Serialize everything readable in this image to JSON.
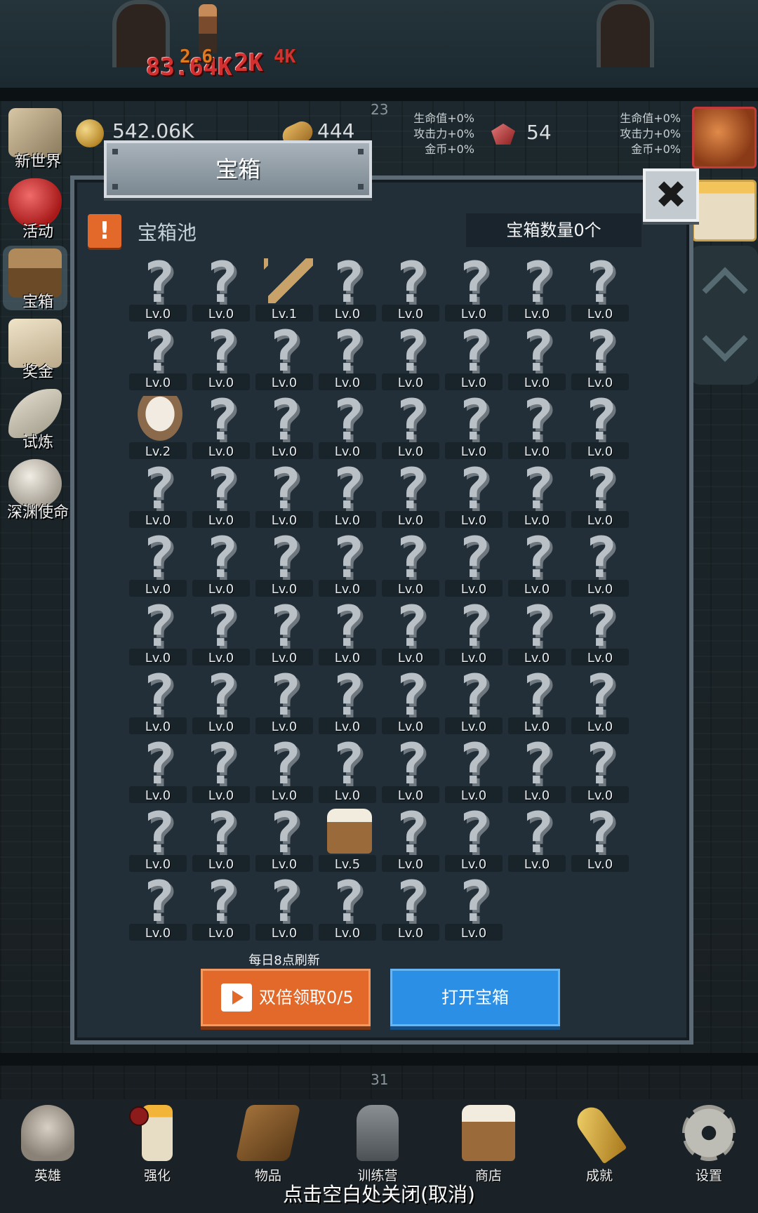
{
  "battle": {
    "damage_1": "83.64K",
    "damage_2": "2.6",
    "damage_3": "2K",
    "damage_4": "4K"
  },
  "resources": {
    "gold": "542.06K",
    "bread": "444",
    "gem": "54",
    "left_wave": "23",
    "bottom_wave": "31",
    "left_buffs": [
      "生命值+0%",
      "攻击力+0%",
      "金币+0%"
    ],
    "right_buffs": [
      "生命值+0%",
      "攻击力+0%",
      "金币+0%"
    ]
  },
  "sidebar": {
    "items": [
      {
        "label": "新世界",
        "icon": "map-icon"
      },
      {
        "label": "活动",
        "icon": "heart-icon"
      },
      {
        "label": "宝箱",
        "icon": "treasure-chest-icon"
      },
      {
        "label": "奖金",
        "icon": "envelope-icon"
      },
      {
        "label": "试炼",
        "icon": "feather-icon"
      },
      {
        "label": "深渊使命",
        "icon": "orb-icon"
      }
    ]
  },
  "dialog": {
    "title": "宝箱",
    "close_label": "✖",
    "alert_mark": "!",
    "pool_title": "宝箱池",
    "chest_count": "宝箱数量0个",
    "refresh_note": "每日8点刷新",
    "double_claim_label": "双倍领取0/5",
    "open_chest_label": "打开宝箱",
    "slots": [
      "Lv.0",
      "Lv.0",
      "Lv.1",
      "Lv.0",
      "Lv.0",
      "Lv.0",
      "Lv.0",
      "Lv.0",
      "Lv.0",
      "Lv.0",
      "Lv.0",
      "Lv.0",
      "Lv.0",
      "Lv.0",
      "Lv.0",
      "Lv.0",
      "Lv.2",
      "Lv.0",
      "Lv.0",
      "Lv.0",
      "Lv.0",
      "Lv.0",
      "Lv.0",
      "Lv.0",
      "Lv.0",
      "Lv.0",
      "Lv.0",
      "Lv.0",
      "Lv.0",
      "Lv.0",
      "Lv.0",
      "Lv.0",
      "Lv.0",
      "Lv.0",
      "Lv.0",
      "Lv.0",
      "Lv.0",
      "Lv.0",
      "Lv.0",
      "Lv.0",
      "Lv.0",
      "Lv.0",
      "Lv.0",
      "Lv.0",
      "Lv.0",
      "Lv.0",
      "Lv.0",
      "Lv.0",
      "Lv.0",
      "Lv.0",
      "Lv.0",
      "Lv.0",
      "Lv.0",
      "Lv.0",
      "Lv.0",
      "Lv.0",
      "Lv.0",
      "Lv.0",
      "Lv.0",
      "Lv.0",
      "Lv.0",
      "Lv.0",
      "Lv.0",
      "Lv.0",
      "Lv.0",
      "Lv.0",
      "Lv.0",
      "Lv.5",
      "Lv.0",
      "Lv.0",
      "Lv.0",
      "Lv.0",
      "Lv.0",
      "Lv.0",
      "Lv.0",
      "Lv.0",
      "Lv.0",
      "Lv.0"
    ],
    "slot_icons": {
      "2": "sword-icon",
      "16": "rice-bowl-icon",
      "67": "beer-mug-icon"
    }
  },
  "bottom_nav": {
    "items": [
      {
        "label": "英雄",
        "icon": "skull-icon"
      },
      {
        "label": "强化",
        "icon": "candle-icon"
      },
      {
        "label": "物品",
        "icon": "book-icon"
      },
      {
        "label": "训练营",
        "icon": "lantern-icon"
      },
      {
        "label": "商店",
        "icon": "beer-mug-icon"
      },
      {
        "label": "成就",
        "icon": "key-icon"
      },
      {
        "label": "设置",
        "icon": "gear-icon"
      }
    ]
  },
  "close_hint": "点击空白处关闭(取消)"
}
